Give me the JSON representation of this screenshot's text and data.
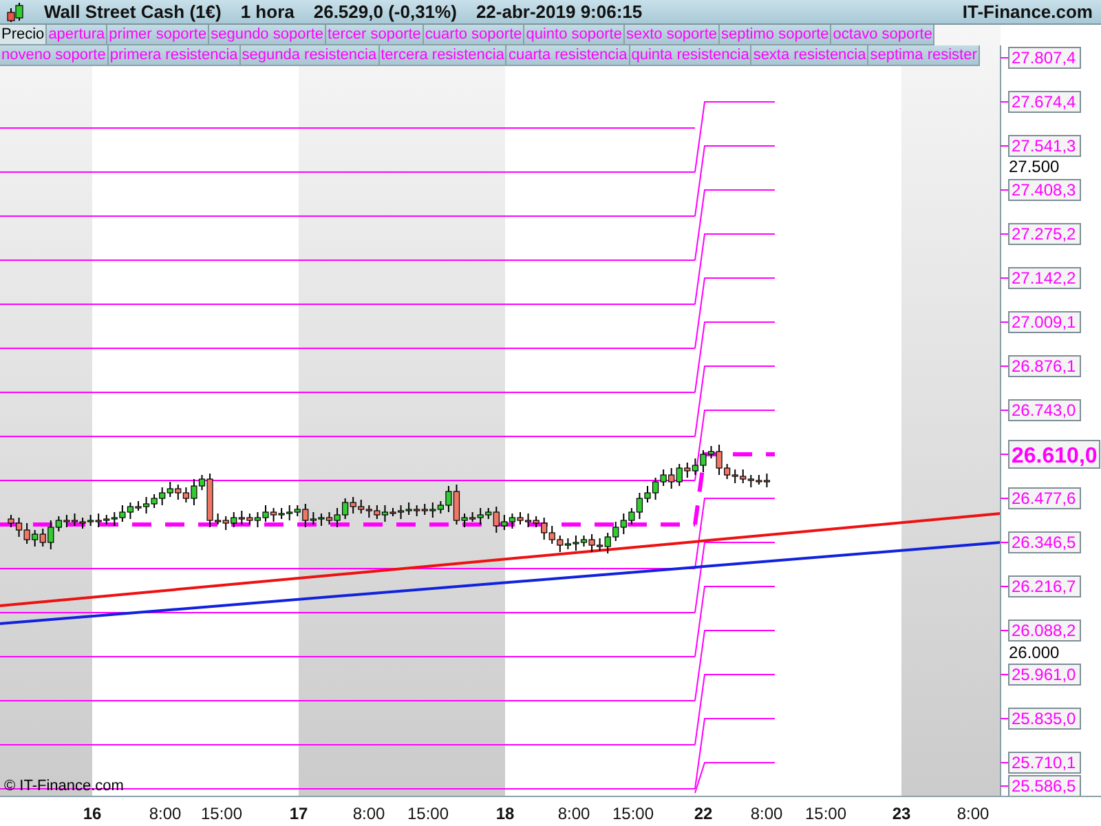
{
  "title_bar": {
    "instrument": "Wall Street Cash (1€)",
    "timeframe": "1 hora",
    "quote": "26.529,0 (-0,31%)",
    "timestamp": "22-abr-2019 9:06:15",
    "site": "IT-Finance.com"
  },
  "legend": [
    {
      "label": "Precio",
      "kind": "price"
    },
    {
      "label": "apertura",
      "kind": "pivot"
    },
    {
      "label": "primer soporte",
      "kind": "pivot"
    },
    {
      "label": "segundo soporte",
      "kind": "pivot"
    },
    {
      "label": "tercer soporte",
      "kind": "pivot"
    },
    {
      "label": "cuarto soporte",
      "kind": "pivot"
    },
    {
      "label": "quinto soporte",
      "kind": "pivot"
    },
    {
      "label": "sexto soporte",
      "kind": "pivot"
    },
    {
      "label": "septimo soporte",
      "kind": "pivot"
    },
    {
      "label": "octavo soporte",
      "kind": "pivot"
    },
    {
      "label": "noveno soporte",
      "kind": "pivot"
    },
    {
      "label": "primera resistencia",
      "kind": "pivot"
    },
    {
      "label": "segunda resistencia",
      "kind": "pivot"
    },
    {
      "label": "tercera resistencia",
      "kind": "pivot"
    },
    {
      "label": "cuarta resistencia",
      "kind": "pivot"
    },
    {
      "label": "quinta resistencia",
      "kind": "pivot"
    },
    {
      "label": "sexta resistencia",
      "kind": "pivot"
    },
    {
      "label": "septima resister",
      "kind": "pivot"
    }
  ],
  "price_axis": [
    {
      "text": "27.807,4",
      "kind": "level"
    },
    {
      "text": "27.674,4",
      "kind": "level"
    },
    {
      "text": "27.541,3",
      "kind": "level"
    },
    {
      "text": "27.500",
      "kind": "grid"
    },
    {
      "text": "27.408,3",
      "kind": "level"
    },
    {
      "text": "27.275,2",
      "kind": "level"
    },
    {
      "text": "27.142,2",
      "kind": "level"
    },
    {
      "text": "27.009,1",
      "kind": "level"
    },
    {
      "text": "26.876,1",
      "kind": "level"
    },
    {
      "text": "26.743,0",
      "kind": "level"
    },
    {
      "text": "26.610,0",
      "kind": "current"
    },
    {
      "text": "26.477,6",
      "kind": "level"
    },
    {
      "text": "26.346,5",
      "kind": "level"
    },
    {
      "text": "26.216,7",
      "kind": "level"
    },
    {
      "text": "26.088,2",
      "kind": "level"
    },
    {
      "text": "26.000",
      "kind": "grid"
    },
    {
      "text": "25.961,0",
      "kind": "level"
    },
    {
      "text": "25.835,0",
      "kind": "level"
    },
    {
      "text": "25.710,1",
      "kind": "level"
    },
    {
      "text": "25.586,5",
      "kind": "level"
    }
  ],
  "copyright": "© IT-Finance.com",
  "time_axis": [
    {
      "label": "16",
      "kind": "day"
    },
    {
      "label": "8:00",
      "kind": "hour"
    },
    {
      "label": "15:00",
      "kind": "hour"
    },
    {
      "label": "17",
      "kind": "day"
    },
    {
      "label": "8:00",
      "kind": "hour"
    },
    {
      "label": "15:00",
      "kind": "hour"
    },
    {
      "label": "18",
      "kind": "day"
    },
    {
      "label": "8:00",
      "kind": "hour"
    },
    {
      "label": "15:00",
      "kind": "hour"
    },
    {
      "label": "22",
      "kind": "day"
    },
    {
      "label": "8:00",
      "kind": "hour"
    },
    {
      "label": "15:00",
      "kind": "hour"
    },
    {
      "label": "23",
      "kind": "day"
    },
    {
      "label": "8:00",
      "kind": "hour"
    }
  ]
}
